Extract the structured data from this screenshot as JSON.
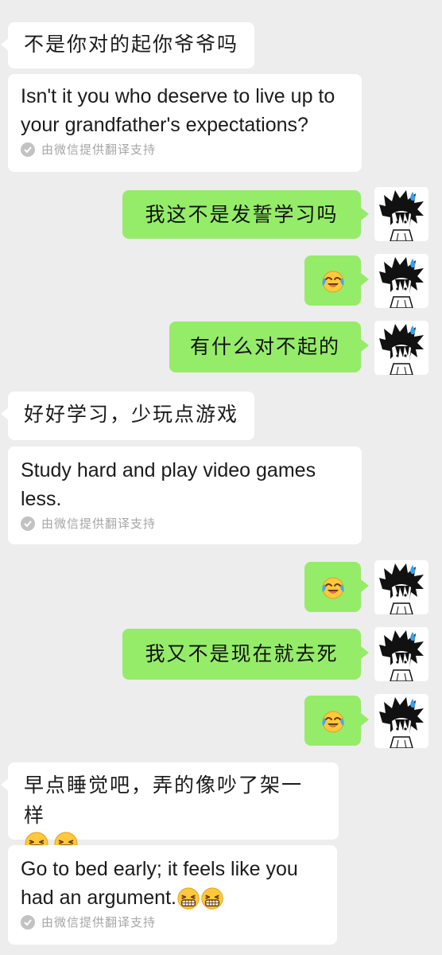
{
  "messages": {
    "m1": {
      "text": "不是你对的起你爷爷吗"
    },
    "m1t": {
      "text": "Isn't it you who deserve to live up to your grandfather's expectations?"
    },
    "m2": {
      "text": "我这不是发誓学习吗"
    },
    "m3": {
      "emoji": "tears-of-joy"
    },
    "m4": {
      "text": "有什么对不起的"
    },
    "m5": {
      "text": "好好学习，少玩点游戏"
    },
    "m5t": {
      "text": "Study hard and play video games less."
    },
    "m6": {
      "emoji": "tears-of-joy"
    },
    "m7": {
      "text": "我又不是现在就去死"
    },
    "m8": {
      "emoji": "tears-of-joy"
    },
    "m9": {
      "text": "早点睡觉吧，弄的像吵了架一样",
      "emoji": [
        "grinning-squint",
        "grinning-squint"
      ]
    },
    "m9t": {
      "text": "Go to bed early; it feels like you had an argument.",
      "emoji": [
        "grinning-squint",
        "grinning-squint"
      ]
    }
  },
  "translation_note": "由微信提供翻译支持",
  "colors": {
    "background": "#ededed",
    "incoming_bubble": "#ffffff",
    "outgoing_bubble": "#95ec69",
    "note_text": "#a6a6a6"
  },
  "icons": {
    "translation_check": "check-circle-icon",
    "avatar": "anime-avatar-sweat-drop"
  }
}
